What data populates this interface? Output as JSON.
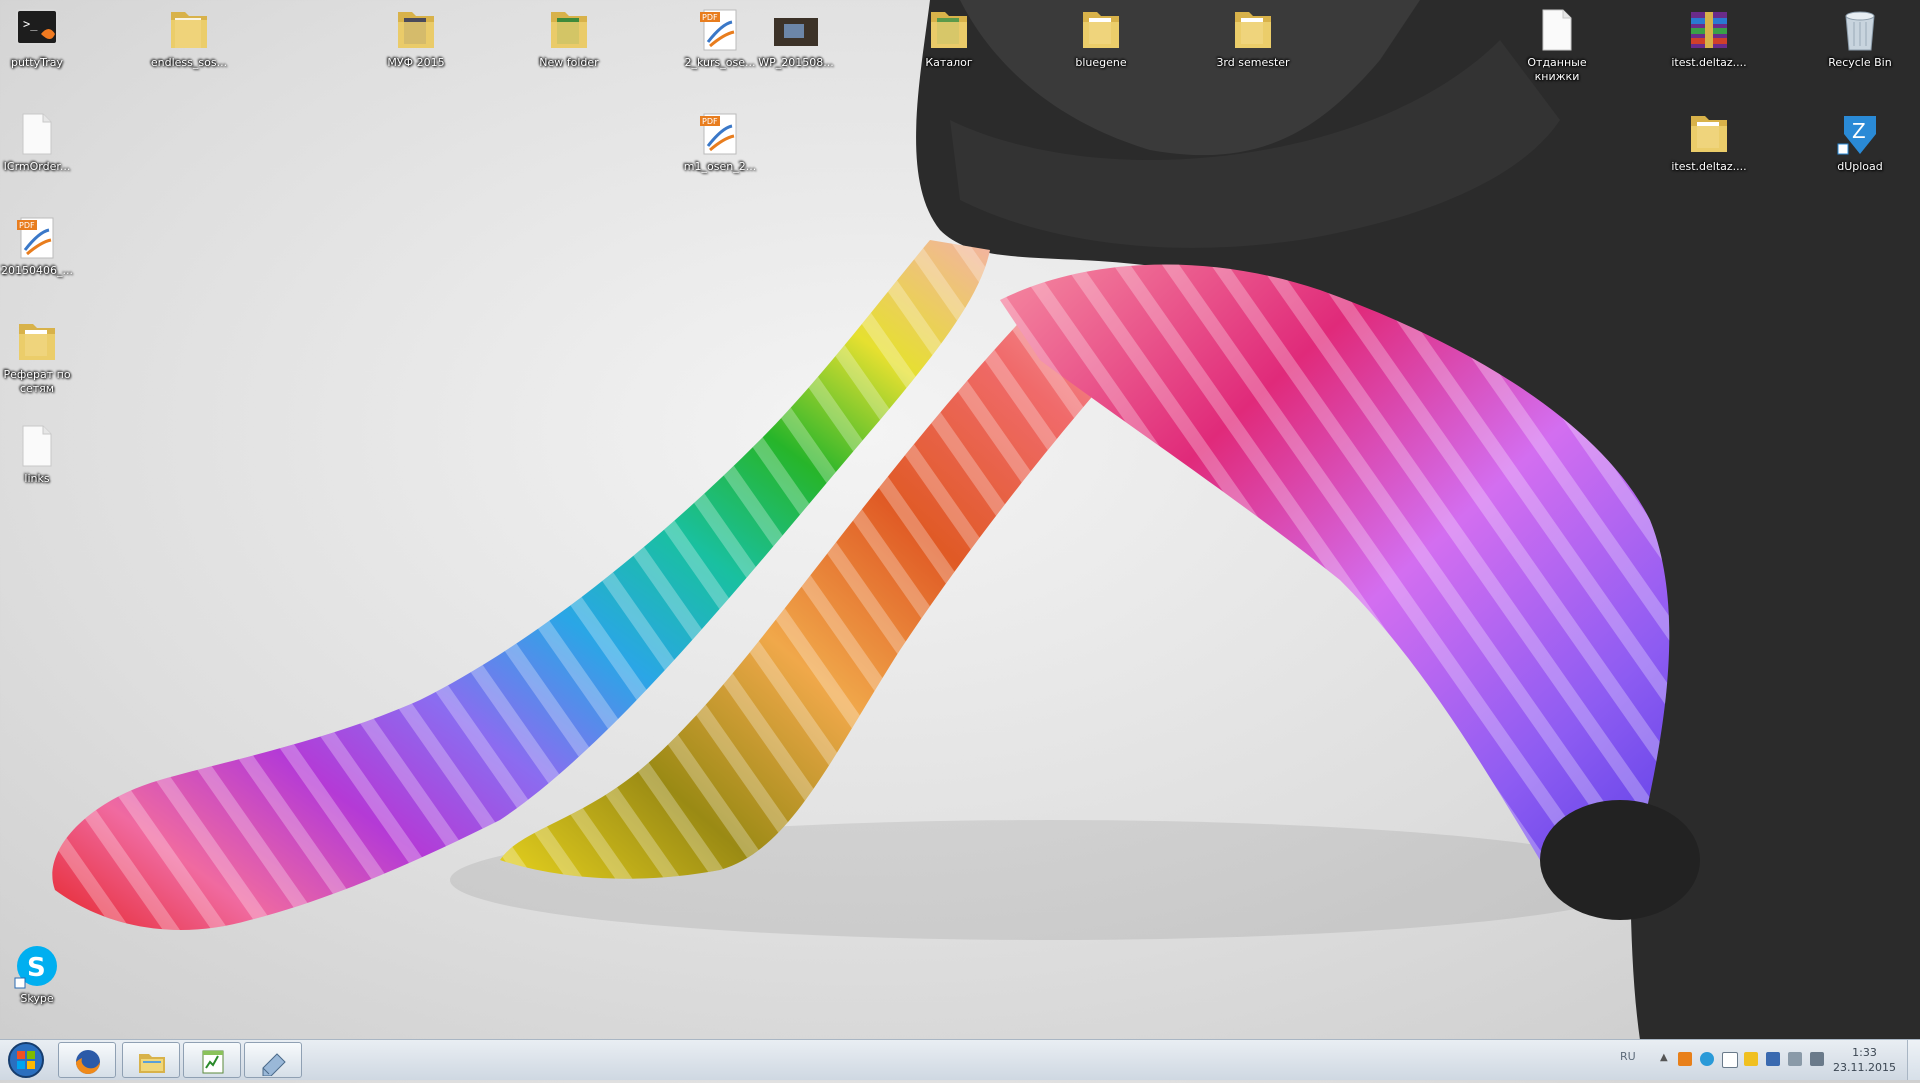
{
  "desktop": {
    "icons": [
      {
        "label": "puttyTray",
        "icon": "putty-icon"
      },
      {
        "label": "endless_sos...",
        "icon": "folder-icon"
      },
      {
        "label": "МУФ 2015",
        "icon": "folder-icon"
      },
      {
        "label": "New folder",
        "icon": "folder-icon"
      },
      {
        "label": "2_kurs_ose...",
        "icon": "pdf-icon"
      },
      {
        "label": "WP_201508...",
        "icon": "image-thumbnail-icon"
      },
      {
        "label": "Каталог",
        "icon": "folder-icon"
      },
      {
        "label": "bluegene",
        "icon": "folder-icon"
      },
      {
        "label": "3rd semester",
        "icon": "folder-icon"
      },
      {
        "label": "Отданные книжки",
        "icon": "file-icon"
      },
      {
        "label": "itest.deltaz....",
        "icon": "winrar-archive-icon"
      },
      {
        "label": "Recycle Bin",
        "icon": "recycle-bin-icon"
      },
      {
        "label": "ICrmOrder...",
        "icon": "file-icon"
      },
      {
        "label": "m1_osen_2...",
        "icon": "pdf-icon"
      },
      {
        "label": "itest.deltaz....",
        "icon": "folder-icon"
      },
      {
        "label": "dUpload",
        "icon": "dupload-icon"
      },
      {
        "label": "20150406_...",
        "icon": "pdf-icon"
      },
      {
        "label": "Реферат по сетям",
        "icon": "folder-icon"
      },
      {
        "label": "links",
        "icon": "file-icon"
      },
      {
        "label": "Skype",
        "icon": "skype-icon"
      }
    ]
  },
  "taskbar": {
    "start": "start-orb-icon",
    "pinned": [
      "firefox-icon",
      "explorer-icon",
      "notepad-plus-icon",
      "eraser-app-icon"
    ],
    "language": "RU",
    "tray_arrow": "▲",
    "clock_time": "1:33",
    "clock_date": "23.11.2015"
  },
  "colors": {
    "folder": "#e8c55a",
    "taskbar": "#dbe3ec",
    "skype": "#00aff0"
  }
}
